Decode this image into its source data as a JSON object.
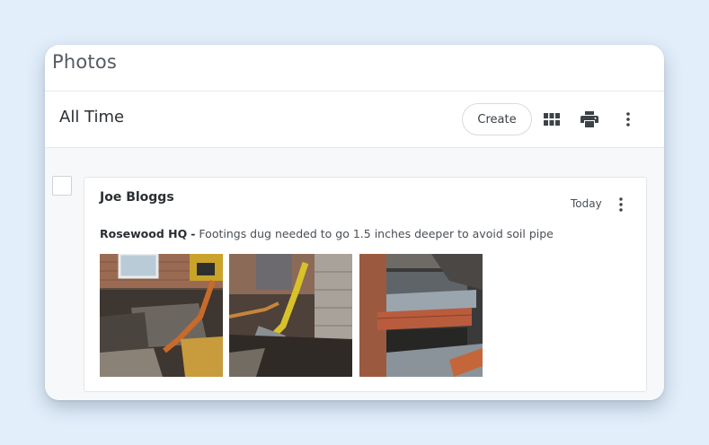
{
  "app": {
    "title": "Photos"
  },
  "toolbar": {
    "title": "All Time",
    "create_label": "Create",
    "icons": [
      "grid-view-icon",
      "print-icon",
      "more-vertical-icon"
    ]
  },
  "entry": {
    "author": "Joe Bloggs",
    "date": "Today",
    "project": "Rosewood HQ",
    "separator": "-",
    "description": "Footings dug needed to go 1.5 inches deeper to avoid soil pipe",
    "photos": [
      {
        "name": "photo-1",
        "subject": "excavated footing trench with orange pipe"
      },
      {
        "name": "photo-2",
        "subject": "trench with yellow excavator and copper pipe"
      },
      {
        "name": "photo-3",
        "subject": "brick and block footing walls in trench"
      }
    ]
  },
  "colors": {
    "background": "#e2eefa",
    "card": "#ffffff",
    "content_bg": "#f7f8f9",
    "text_dark": "#2b2f33",
    "text_muted": "#4a4f55"
  }
}
